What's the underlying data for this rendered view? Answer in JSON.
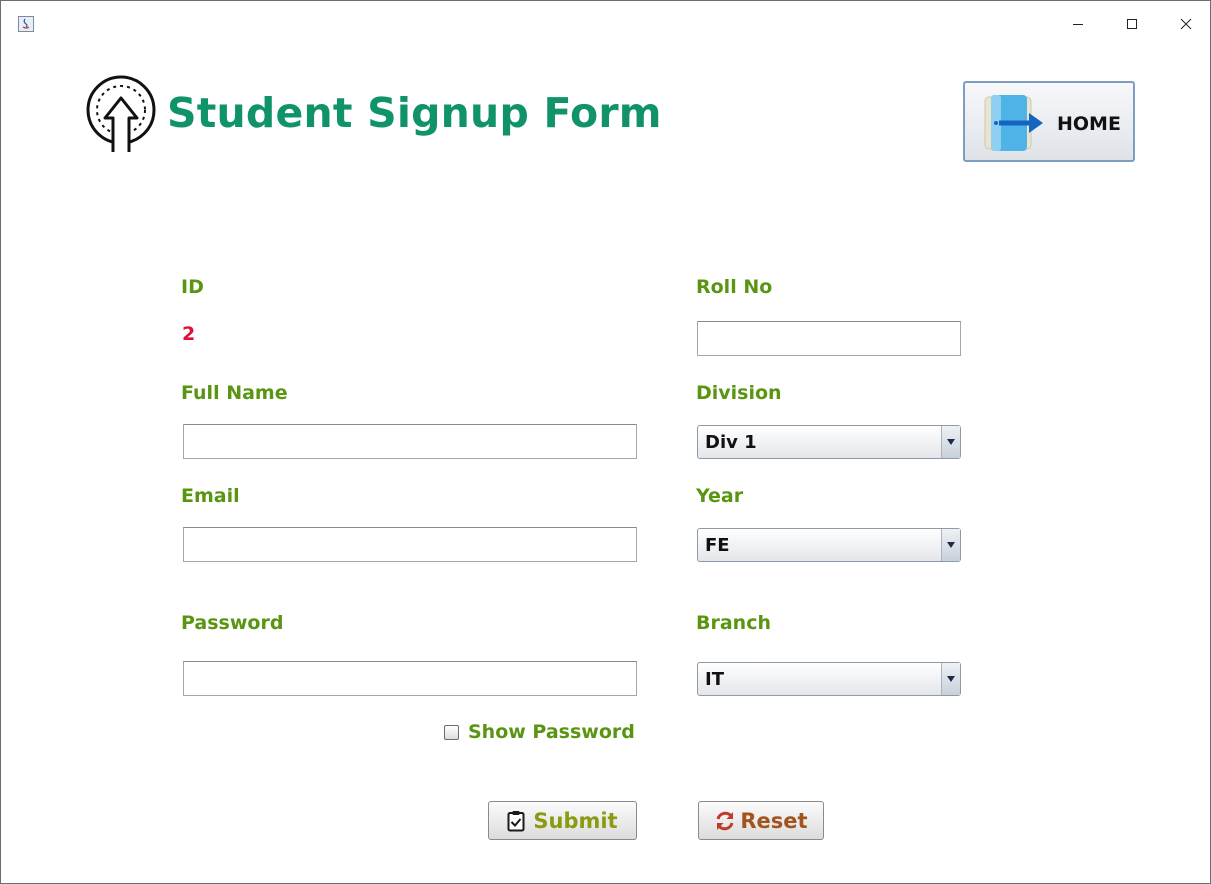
{
  "window": {
    "minimize_glyph": "–",
    "maximize_glyph": "☐",
    "close_glyph": "✕"
  },
  "header": {
    "title": "Student Signup Form",
    "logo_icon": "upload-circle-icon",
    "home_button_label": "HOME",
    "home_icon": "exit-door-icon"
  },
  "form": {
    "id_label": "ID",
    "id_value": "2",
    "rollno_label": "Roll No",
    "rollno_value": "",
    "fullname_label": "Full Name",
    "fullname_value": "",
    "division_label": "Division",
    "division_value": "Div 1",
    "email_label": "Email",
    "email_value": "",
    "year_label": "Year",
    "year_value": "FE",
    "password_label": "Password",
    "password_value": "",
    "branch_label": "Branch",
    "branch_value": "IT",
    "show_password_label": "Show Password",
    "show_password_checked": false
  },
  "actions": {
    "submit_label": "Submit",
    "reset_label": "Reset"
  },
  "colors": {
    "title": "#10936a",
    "label": "#5a9512",
    "id_value": "#e0103a",
    "submit_text": "#8c9a12",
    "reset_icon": "#c0392b"
  }
}
